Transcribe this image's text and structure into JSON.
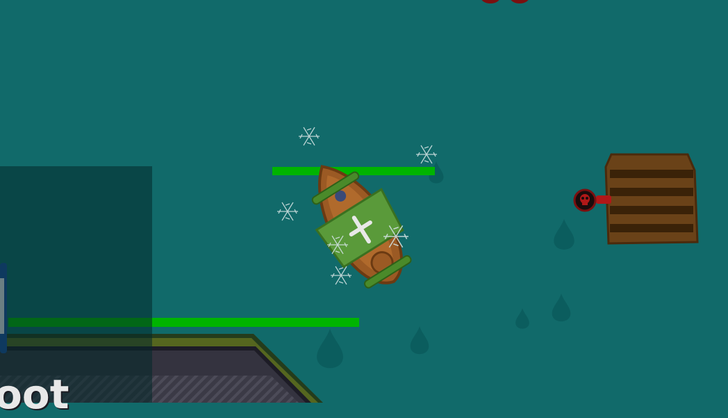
{
  "game": {
    "player_ship": {
      "health_fraction": 1.0,
      "sail_emblem": "cross",
      "sail_color": "#5a9a3a",
      "hull_color": "#9b5a24"
    },
    "loot_crate": {
      "type": "wooden-crate",
      "color": "#6a4218"
    },
    "enemy_cannon": {
      "color": "#b01818",
      "icon": "skull-icon"
    },
    "water_color": "#116a6a",
    "health_bar_color": "#00b400",
    "dock": {
      "health_fraction": 1.0,
      "partial_label": "oot"
    }
  }
}
